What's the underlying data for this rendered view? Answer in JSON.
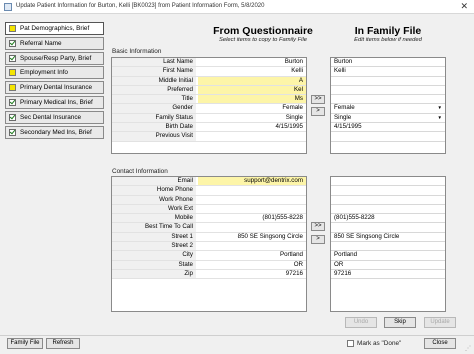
{
  "window": {
    "title": "Update Patient Information for Burton, Kelli [BK0023] from Patient Information Form, 5/8/2020"
  },
  "sidebar": {
    "items": [
      {
        "label": "Pat Demographics, Brief",
        "status": "pending",
        "selected": true
      },
      {
        "label": "Referral Name",
        "status": "done"
      },
      {
        "label": "Spouse/Resp Party, Brief",
        "status": "done"
      },
      {
        "label": "Employment Info",
        "status": "pending"
      },
      {
        "label": "Primary Dental Insurance",
        "status": "pending"
      },
      {
        "label": "Primary Medical Ins, Brief",
        "status": "done"
      },
      {
        "label": "Sec Dental Insurance",
        "status": "done"
      },
      {
        "label": "Secondary Med Ins, Brief",
        "status": "done"
      }
    ]
  },
  "headers": {
    "questionnaire": "From Questionnaire",
    "questionnaire_sub": "Select items to copy to Family File",
    "family": "In Family File",
    "family_sub": "Edit items below if needed"
  },
  "basic": {
    "section_label": "Basic Information",
    "rows": [
      {
        "label": "Last Name",
        "q": "Burton",
        "f": "Burton"
      },
      {
        "label": "First Name",
        "q": "Kelli",
        "f": "Kelli"
      },
      {
        "label": "Middle Initial",
        "q": "A",
        "f": ""
      },
      {
        "label": "Preferred",
        "q": "Kel",
        "f": ""
      },
      {
        "label": "Title",
        "q": "Ms",
        "f": ""
      },
      {
        "label": "Gender",
        "q": "Female",
        "f": "Female"
      },
      {
        "label": "Family Status",
        "q": "Single",
        "f": "Single"
      },
      {
        "label": "Birth Date",
        "q": "4/15/1995",
        "f": "4/15/1995"
      },
      {
        "label": "Previous Visit",
        "q": "",
        "f": ""
      }
    ],
    "copy_all": ">>",
    "copy_one": ">"
  },
  "contact": {
    "section_label": "Contact Information",
    "rows": [
      {
        "label": "Email",
        "q": "support@dentrix.com",
        "f": ""
      },
      {
        "label": "Home Phone",
        "q": "",
        "f": ""
      },
      {
        "label": "Work Phone",
        "q": "",
        "f": ""
      },
      {
        "label": "Work Ext",
        "q": "",
        "f": ""
      },
      {
        "label": "Mobile",
        "q": "(801)555-8228",
        "f": "(801)555-8228"
      },
      {
        "label": "Best Time To Call",
        "q": "",
        "f": ""
      },
      {
        "label": "Street 1",
        "q": "850 SE Singsong Circle",
        "f": "850 SE Singsong Circle"
      },
      {
        "label": "Street 2",
        "q": "",
        "f": ""
      },
      {
        "label": "City",
        "q": "Portland",
        "f": "Portland"
      },
      {
        "label": "State",
        "q": "OR",
        "f": "OR"
      },
      {
        "label": "Zip",
        "q": "97216",
        "f": "97216"
      }
    ],
    "copy_all": ">>",
    "copy_one": ">"
  },
  "actions": {
    "undo": "Undo",
    "skip": "Skip",
    "update": "Update"
  },
  "footer": {
    "family_file": "Family File",
    "refresh": "Refresh",
    "mark_done": "Mark as \"Done\"",
    "close": "Close"
  },
  "icons": {
    "dropdown": "dropdown-arrow-icon",
    "check": "check-icon",
    "close": "close-icon"
  }
}
